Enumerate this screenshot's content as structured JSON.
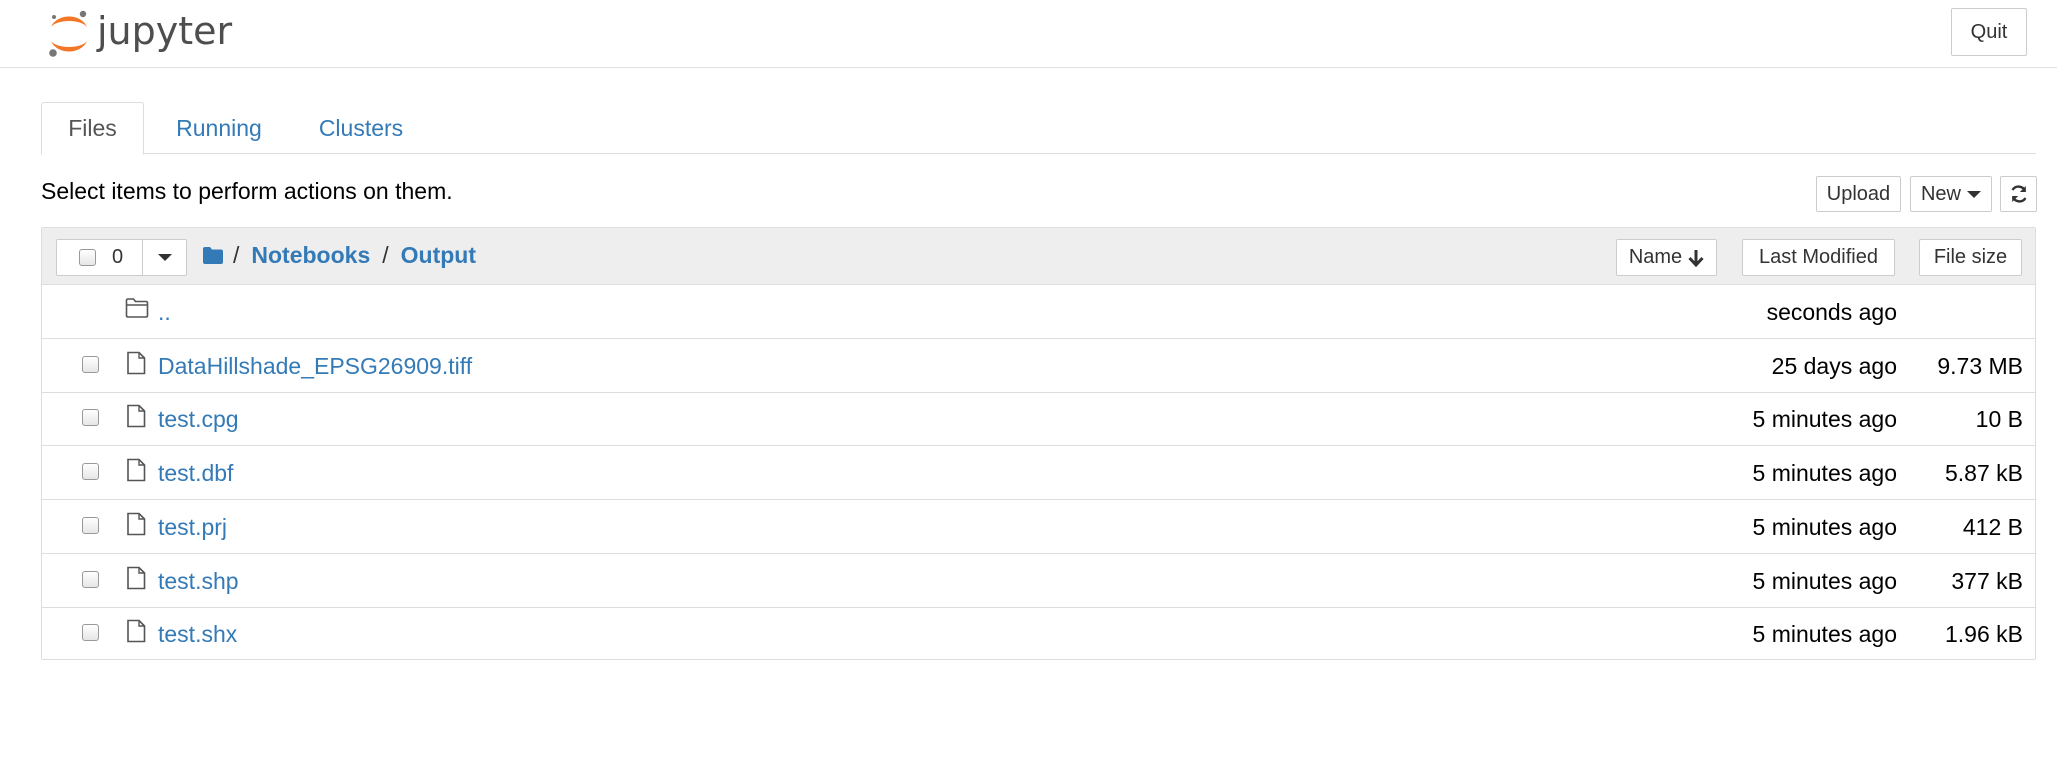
{
  "header": {
    "logo_text": "jupyter",
    "quit_label": "Quit"
  },
  "tabs": [
    {
      "label": "Files",
      "active": true
    },
    {
      "label": "Running",
      "active": false
    },
    {
      "label": "Clusters",
      "active": false
    }
  ],
  "toolbar": {
    "hint": "Select items to perform actions on them.",
    "upload_label": "Upload",
    "new_label": "New",
    "refresh_icon": "refresh-icon"
  },
  "list_header": {
    "selected_count": "0",
    "breadcrumb": [
      "Notebooks",
      "Output"
    ],
    "separator": "/",
    "sort_name_label": "Name",
    "sort_name_icon": "arrow-down-icon",
    "sort_modified_label": "Last Modified",
    "sort_size_label": "File size"
  },
  "rows": [
    {
      "name": "..",
      "type": "folder",
      "modified": "seconds ago",
      "size": ""
    },
    {
      "name": "DataHillshade_EPSG26909.tiff",
      "type": "file",
      "modified": "25 days ago",
      "size": "9.73 MB"
    },
    {
      "name": "test.cpg",
      "type": "file",
      "modified": "5 minutes ago",
      "size": "10 B"
    },
    {
      "name": "test.dbf",
      "type": "file",
      "modified": "5 minutes ago",
      "size": "5.87 kB"
    },
    {
      "name": "test.prj",
      "type": "file",
      "modified": "5 minutes ago",
      "size": "412 B"
    },
    {
      "name": "test.shp",
      "type": "file",
      "modified": "5 minutes ago",
      "size": "377 kB"
    },
    {
      "name": "test.shx",
      "type": "file",
      "modified": "5 minutes ago",
      "size": "1.96 kB"
    }
  ],
  "colors": {
    "link": "#337ab7",
    "logo_orange": "#f37726",
    "logo_gray": "#767677",
    "header_bg": "#eeeeee",
    "border": "#dddddd"
  }
}
